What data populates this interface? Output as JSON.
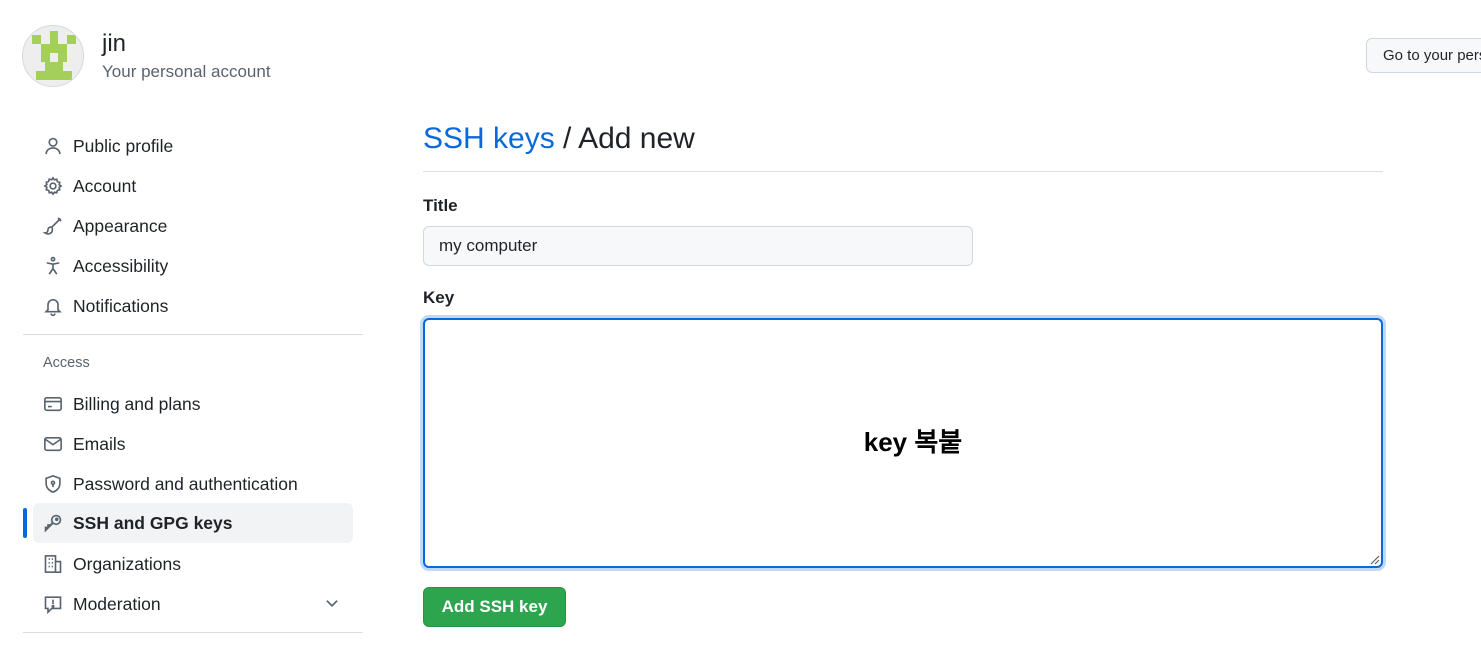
{
  "header": {
    "user_name": "jin",
    "user_subtitle": "Your personal account",
    "profile_button": "Go to your personal profile"
  },
  "sidebar": {
    "items": [
      {
        "label": "Public profile",
        "icon": "person-icon"
      },
      {
        "label": "Account",
        "icon": "gear-icon"
      },
      {
        "label": "Appearance",
        "icon": "paintbrush-icon"
      },
      {
        "label": "Accessibility",
        "icon": "accessibility-icon"
      },
      {
        "label": "Notifications",
        "icon": "bell-icon"
      }
    ],
    "access_label": "Access",
    "access_items": [
      {
        "label": "Billing and plans",
        "icon": "credit-card-icon"
      },
      {
        "label": "Emails",
        "icon": "mail-icon"
      },
      {
        "label": "Password and authentication",
        "icon": "shield-icon"
      },
      {
        "label": "SSH and GPG keys",
        "icon": "key-icon",
        "active": true
      },
      {
        "label": "Organizations",
        "icon": "organization-icon"
      },
      {
        "label": "Moderation",
        "icon": "report-icon",
        "expandable": true
      }
    ]
  },
  "main": {
    "breadcrumb_link": "SSH keys",
    "breadcrumb_rest": " / Add new",
    "title_label": "Title",
    "title_value": "my computer",
    "key_label": "Key",
    "key_overlay_text": "key 복붙",
    "submit_label": "Add SSH key"
  },
  "colors": {
    "accent": "#0969da",
    "primary_button": "#2da44e",
    "avatar_green": "#a3cf5a"
  }
}
